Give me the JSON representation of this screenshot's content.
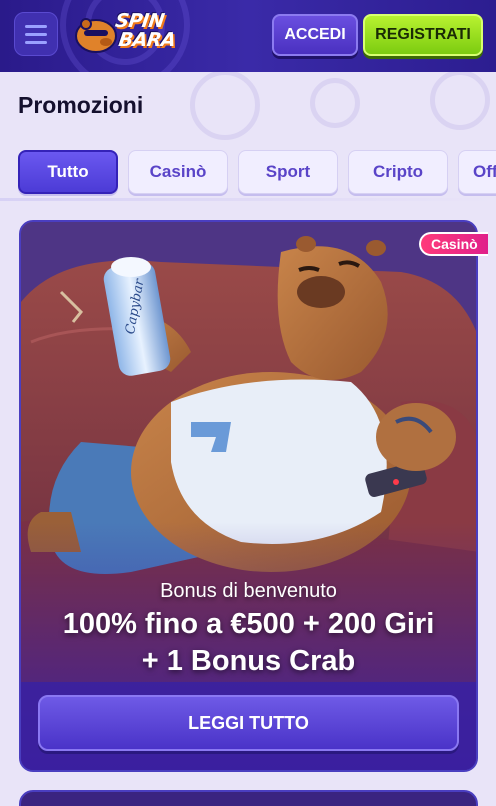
{
  "header": {
    "logo_line1": "SPIN",
    "logo_line2": "BARA",
    "login_label": "ACCEDI",
    "register_label": "REGISTRATI"
  },
  "page": {
    "title": "Promozioni"
  },
  "tabs": [
    {
      "label": "Tutto",
      "active": true
    },
    {
      "label": "Casinò",
      "active": false
    },
    {
      "label": "Sport",
      "active": false
    },
    {
      "label": "Cripto",
      "active": false
    },
    {
      "label": "Off",
      "active": false
    }
  ],
  "promo": {
    "badge": "Casinò",
    "subtitle": "Bonus di benvenuto",
    "headline_line1": "100% fino a €500 + 200 Giri",
    "headline_line2": "+ 1 Bonus Crab",
    "cta_label": "LEGGI TUTTO",
    "can_label": "Capybar"
  },
  "colors": {
    "header_bg": "#2a1a8a",
    "accent_purple": "#5a44c8",
    "register_green": "#9ee020",
    "badge_pink": "#ff3a7a"
  }
}
